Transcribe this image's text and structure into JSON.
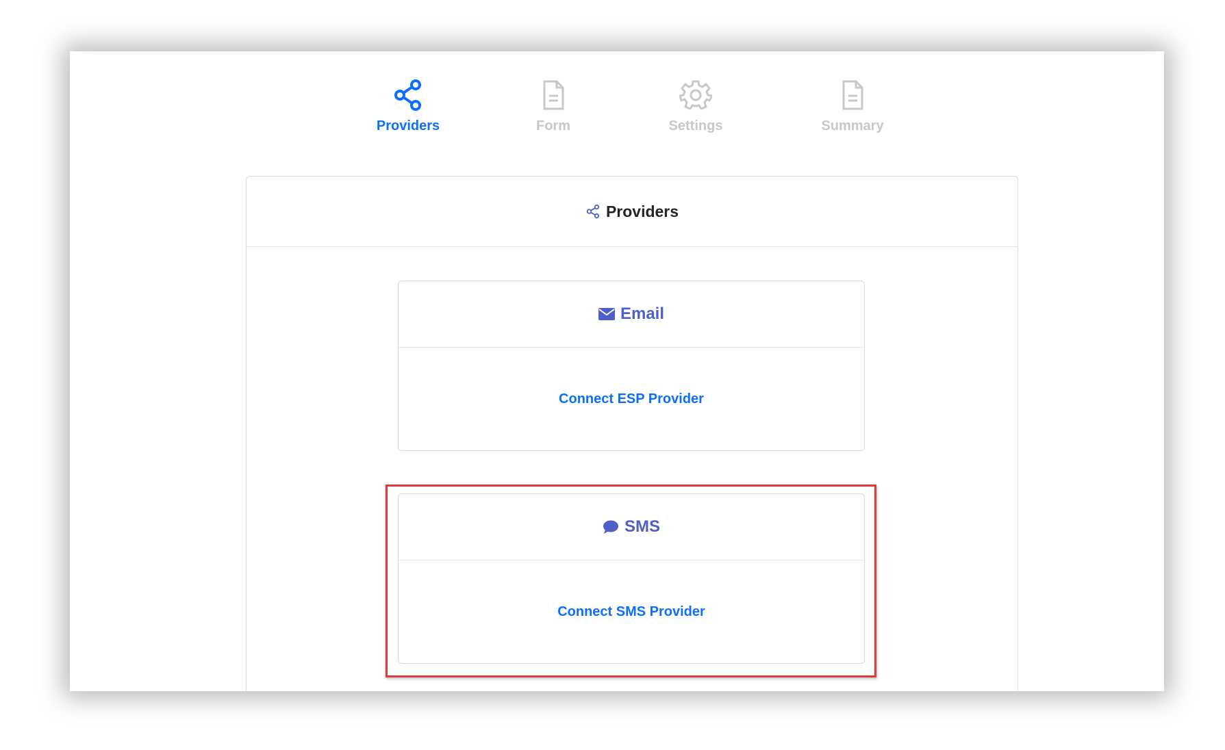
{
  "steps": [
    {
      "label": "Providers",
      "icon": "share-icon",
      "active": true
    },
    {
      "label": "Form",
      "icon": "document-icon",
      "active": false
    },
    {
      "label": "Settings",
      "icon": "gear-icon",
      "active": false
    },
    {
      "label": "Summary",
      "icon": "document-icon",
      "active": false
    }
  ],
  "panel": {
    "title": "Providers",
    "icon": "share-icon"
  },
  "email_card": {
    "title": "Email",
    "icon": "envelope-icon",
    "link": "Connect ESP Provider"
  },
  "sms_card": {
    "title": "SMS",
    "icon": "chat-bubble-icon",
    "link": "Connect SMS Provider"
  },
  "colors": {
    "active_step": "#0d6efd",
    "inactive_step": "#c8c8c8",
    "card_title": "#4e5fc7",
    "link": "#0d6efd",
    "highlight_border": "#e03b3b"
  }
}
